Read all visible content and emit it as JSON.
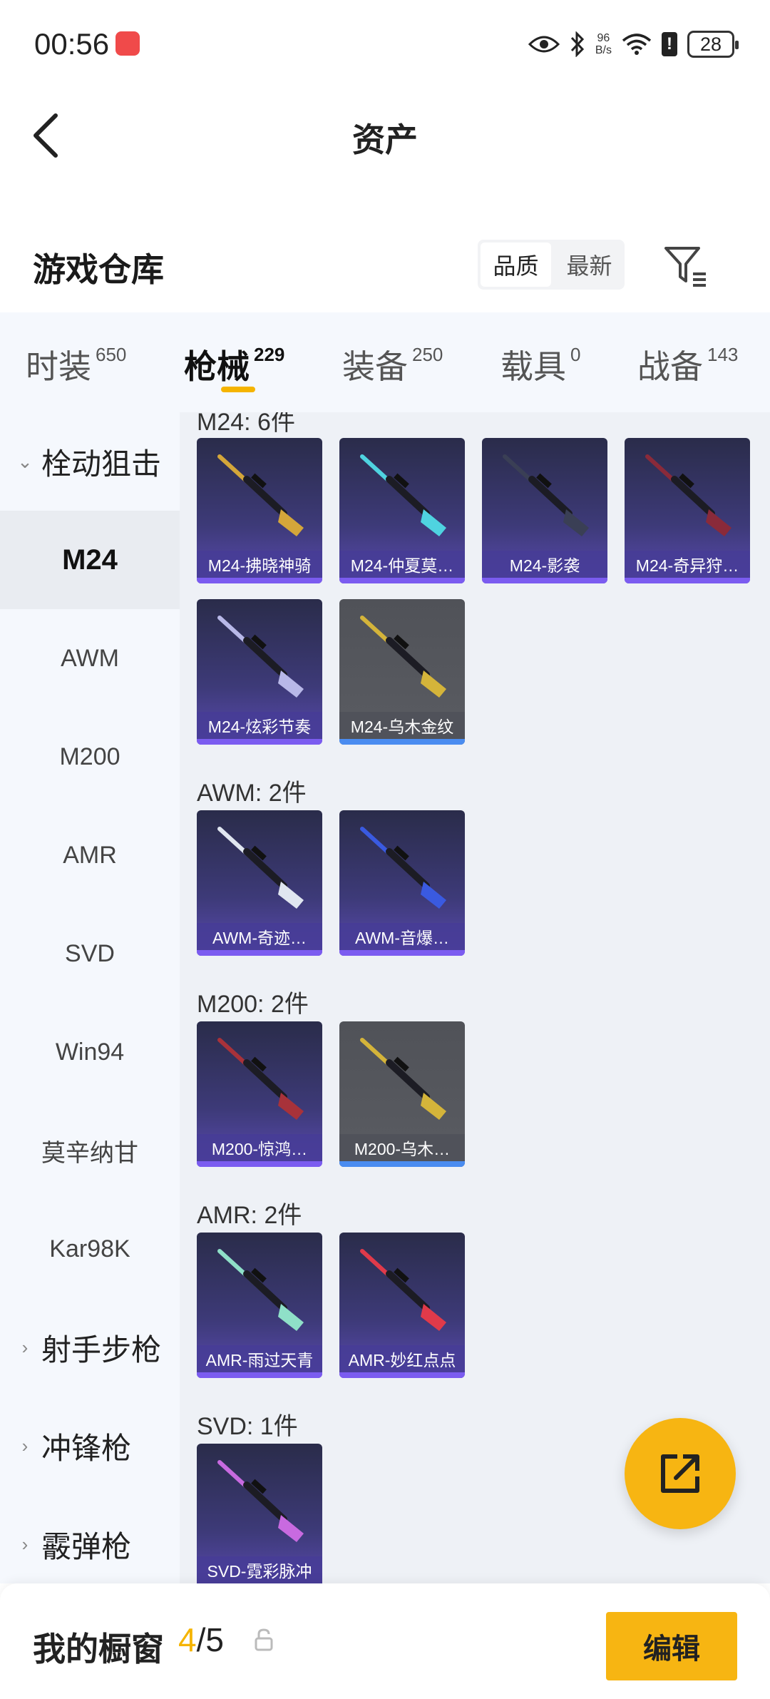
{
  "status": {
    "time": "00:56",
    "net_speed_value": "96",
    "net_speed_unit": "B/s",
    "battery": "28"
  },
  "header": {
    "title": "资产"
  },
  "warehouse": {
    "title": "游戏仓库",
    "sort_options": [
      "品质",
      "最新"
    ],
    "active_sort": "品质"
  },
  "tabs": [
    {
      "label": "时装",
      "count": "650"
    },
    {
      "label": "枪械",
      "count": "229"
    },
    {
      "label": "装备",
      "count": "250"
    },
    {
      "label": "载具",
      "count": "0"
    },
    {
      "label": "战备",
      "count": "143"
    }
  ],
  "active_tab": "枪械",
  "sidebar": {
    "group_sniper": "栓动狙击",
    "items": [
      "M24",
      "AWM",
      "M200",
      "AMR",
      "SVD",
      "Win94",
      "莫辛纳甘",
      "Kar98K"
    ],
    "active_item": "M24",
    "groups_collapsed": [
      "射手步枪",
      "冲锋枪",
      "霰弹枪"
    ]
  },
  "sections": [
    {
      "header": "M24: 6件",
      "items": [
        {
          "name": "M24-拂晓神骑",
          "style": "purple",
          "accent": "#d4a63a"
        },
        {
          "name": "M24-仲夏莫…",
          "style": "purple",
          "accent": "#4fd3e0"
        },
        {
          "name": "M24-影袭",
          "style": "purple",
          "accent": "#3a3f55"
        },
        {
          "name": "M24-奇异狩…",
          "style": "purple",
          "accent": "#8a2a3a"
        },
        {
          "name": "M24-炫彩节奏",
          "style": "purple",
          "accent": "#b8b8e8"
        },
        {
          "name": "M24-乌木金纹",
          "style": "grey",
          "accent": "#d4b43a"
        }
      ]
    },
    {
      "header": "AWM: 2件",
      "items": [
        {
          "name": "AWM-奇迹…",
          "style": "purple",
          "accent": "#e0e6f0"
        },
        {
          "name": "AWM-音爆…",
          "style": "purple",
          "accent": "#3a5ae0"
        }
      ]
    },
    {
      "header": "M200: 2件",
      "items": [
        {
          "name": "M200-惊鸿…",
          "style": "purple",
          "accent": "#a8323a"
        },
        {
          "name": "M200-乌木…",
          "style": "grey",
          "accent": "#d4b43a"
        }
      ]
    },
    {
      "header": "AMR: 2件",
      "items": [
        {
          "name": "AMR-雨过天青",
          "style": "purple",
          "accent": "#8fe0c8"
        },
        {
          "name": "AMR-妙红点点",
          "style": "purple",
          "accent": "#e03a4a"
        }
      ]
    },
    {
      "header": "SVD: 1件",
      "items": [
        {
          "name": "SVD-霓彩脉冲",
          "style": "purple",
          "accent": "#c86ae0"
        }
      ]
    }
  ],
  "bottom": {
    "label": "我的橱窗",
    "current": "4",
    "total": "5",
    "edit_label": "编辑"
  }
}
